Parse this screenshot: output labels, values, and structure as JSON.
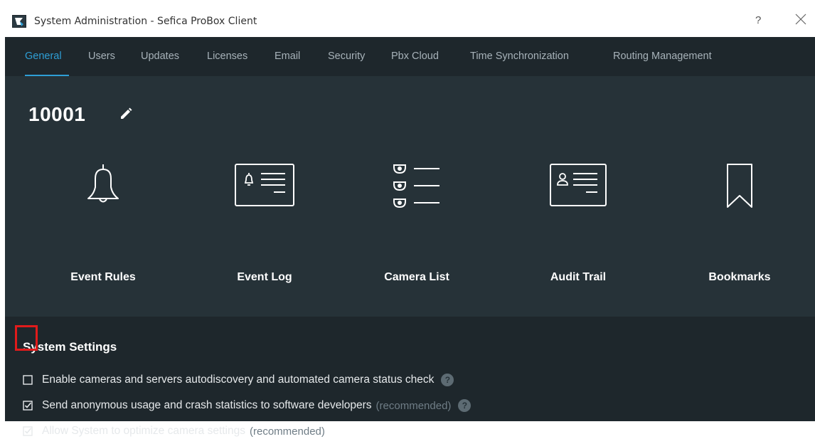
{
  "window": {
    "title": "System Administration - Sefica ProBox Client",
    "help_label": "?",
    "icons": {
      "app": "app-logo-icon",
      "close": "close-icon"
    }
  },
  "tabs": [
    {
      "label": "General",
      "active": true
    },
    {
      "label": "Users",
      "active": false
    },
    {
      "label": "Updates",
      "active": false
    },
    {
      "label": "Licenses",
      "active": false
    },
    {
      "label": "Email",
      "active": false
    },
    {
      "label": "Security",
      "active": false
    },
    {
      "label": "Pbx Cloud",
      "active": false
    },
    {
      "label": "Time Synchronization",
      "active": false
    },
    {
      "label": "Routing Management",
      "active": false
    }
  ],
  "server": {
    "name": "10001",
    "edit_icon": "pencil-icon"
  },
  "tiles": [
    {
      "label": "Event Rules",
      "icon": "bell-icon"
    },
    {
      "label": "Event Log",
      "icon": "event-log-icon"
    },
    {
      "label": "Camera List",
      "icon": "camera-list-icon"
    },
    {
      "label": "Audit Trail",
      "icon": "audit-trail-icon"
    },
    {
      "label": "Bookmarks",
      "icon": "bookmark-icon"
    }
  ],
  "settings": {
    "title": "System Settings",
    "options": [
      {
        "label": "Enable cameras and servers autodiscovery and automated camera status check",
        "suffix": "",
        "checked": false,
        "has_help": true
      },
      {
        "label": "Send anonymous usage and crash statistics to software developers",
        "suffix": "(recommended)",
        "checked": true,
        "has_help": true
      },
      {
        "label": "Allow System to optimize camera settings",
        "suffix": "(recommended)",
        "checked": true,
        "has_help": false
      }
    ],
    "help_glyph": "?"
  },
  "colors": {
    "accent": "#2e9fd6",
    "background": "#263238",
    "panel": "#1e272c",
    "highlight": "#e11b1b"
  }
}
